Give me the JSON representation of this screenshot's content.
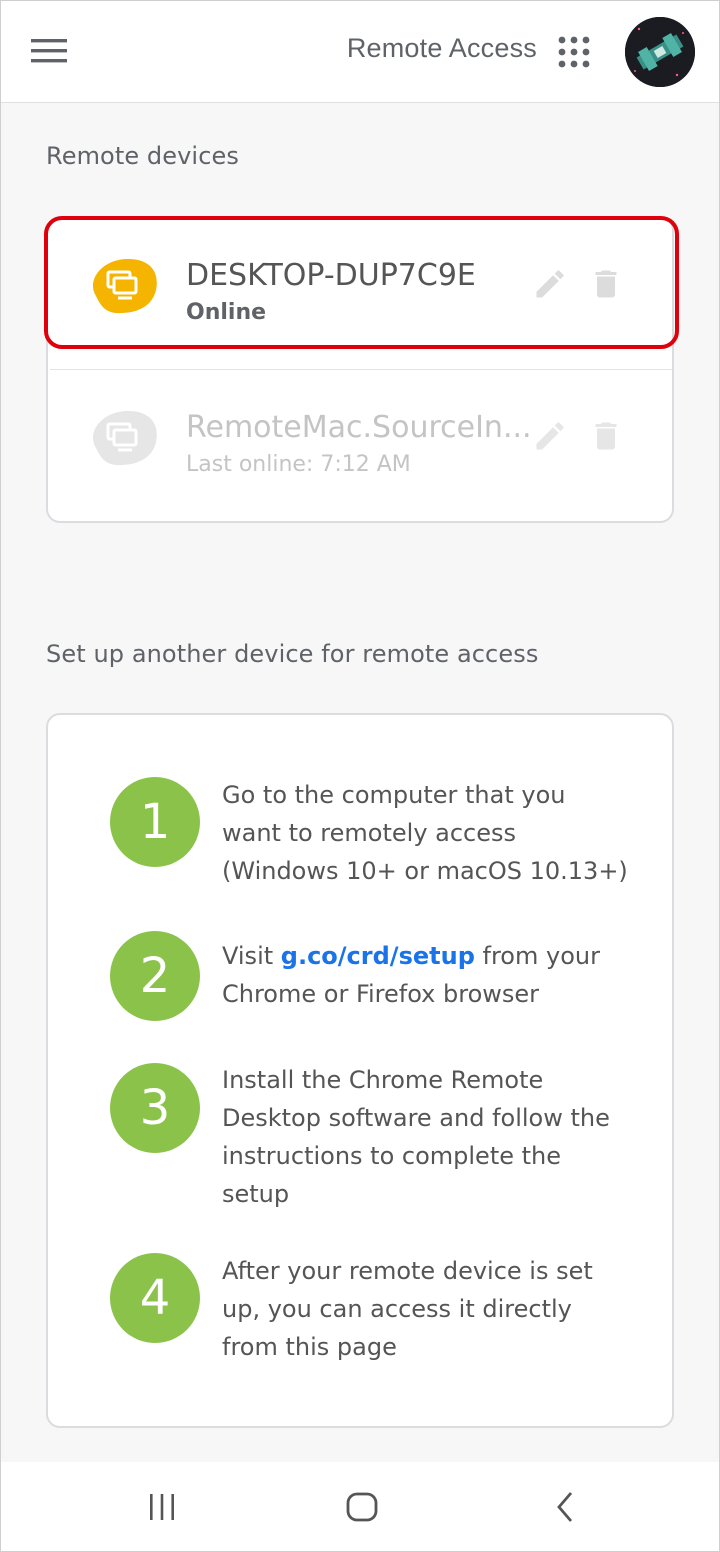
{
  "header": {
    "title": "Remote Access"
  },
  "remote_devices": {
    "section_title": "Remote devices",
    "devices": [
      {
        "name": "DESKTOP-DUP7C9E",
        "status": "Online",
        "status_color": "#5f6368",
        "icon_color": "#f4b400"
      },
      {
        "name": "RemoteMac.SourceIn...",
        "status": "Last online: 7:12 AM",
        "status_color": "#c4c4c4",
        "icon_color": "#e6e6e6"
      }
    ]
  },
  "setup": {
    "section_title": "Set up another device for remote access",
    "steps": [
      {
        "number": "1",
        "text": "Go to the computer that you want to remotely access (Windows 10+ or macOS 10.13+)"
      },
      {
        "number": "2",
        "text_before": "Visit ",
        "link": "g.co/crd/setup",
        "text_after": " from your Chrome or Firefox browser"
      },
      {
        "number": "3",
        "text": "Install the Chrome Remote Desktop software and follow the instructions to complete the setup"
      },
      {
        "number": "4",
        "text": "After your remote device is set up, you can access it directly from this page"
      }
    ]
  },
  "colors": {
    "accent_yellow": "#f4b400",
    "step_green": "#8bc34a",
    "link_blue": "#1a73e8",
    "highlight_red": "#e0000b"
  }
}
